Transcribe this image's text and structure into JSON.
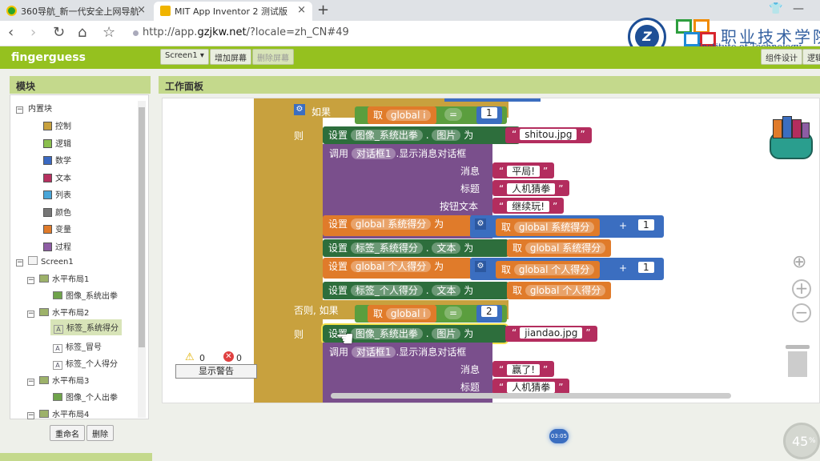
{
  "browser": {
    "tab_inactive": "360导航_新一代安全上网导航",
    "tab_active": "MIT App Inventor 2 测试版",
    "url_prefix": "http://app.",
    "url_domain": "gzjkw.net",
    "url_suffix": "/?locale=zh_CN#49"
  },
  "watermark": {
    "seal": "Z",
    "title": "职业技术学院",
    "subtitle": "Institute of Technology"
  },
  "app": {
    "name": "fingerguess",
    "screen_select": "Screen1 ▾",
    "add_screen": "增加屏幕",
    "remove_screen": "删除屏幕",
    "component_design": "组件设计",
    "logic_design": "逻辑"
  },
  "panels": {
    "modules": "模块",
    "workspace": "工作面板"
  },
  "tree": {
    "builtin": "内置块",
    "builtin_items": [
      {
        "label": "控制",
        "color": "#c8a13e"
      },
      {
        "label": "逻辑",
        "color": "#8bbf4e"
      },
      {
        "label": "数学",
        "color": "#3a69c2"
      },
      {
        "label": "文本",
        "color": "#b73060"
      },
      {
        "label": "列表",
        "color": "#49a6d9"
      },
      {
        "label": "颜色",
        "color": "#777777"
      },
      {
        "label": "变量",
        "color": "#e07b2a"
      },
      {
        "label": "过程",
        "color": "#8e5da4"
      }
    ],
    "screen": "Screen1",
    "components": [
      "水平布局1",
      "图像_系统出拳",
      "水平布局2",
      "标签_系统得分",
      "标签_冒号",
      "标签_个人得分",
      "水平布局3",
      "图像_个人出拳",
      "水平布局4"
    ],
    "rename_button": "重命名",
    "delete_button": "删除"
  },
  "warnings": {
    "warning_count": "0",
    "error_count": "0",
    "show_button": "显示警告"
  },
  "blocks": {
    "if_label": "如果",
    "get": "取",
    "global_i": "global i",
    "eq": "=",
    "num1": "1",
    "num2": "2",
    "then": "则",
    "else_if": "否则, 如果",
    "set": "设置",
    "img_sys": "图像_系统出拳",
    "picture": "图片",
    "to": "为",
    "shitou": "shitou.jpg",
    "jiandao": "jiandao.jpg",
    "call": "调用",
    "dialog": "对话框1",
    "show_msg": ".显示消息对话框",
    "message": "消息",
    "title": "标题",
    "button_text": "按钮文本",
    "tie": "平局!",
    "win": "赢了!",
    "game_title": "人机猜拳",
    "continue": "继续玩!",
    "global_sys_score": "global 系统得分",
    "global_my_score": "global 个人得分",
    "plus": "+",
    "label_sys": "标签_系统得分",
    "label_my": "标签_个人得分",
    "text": "文本",
    "dot": "."
  },
  "video": {
    "timestamp": "03:05",
    "percent": "45"
  }
}
